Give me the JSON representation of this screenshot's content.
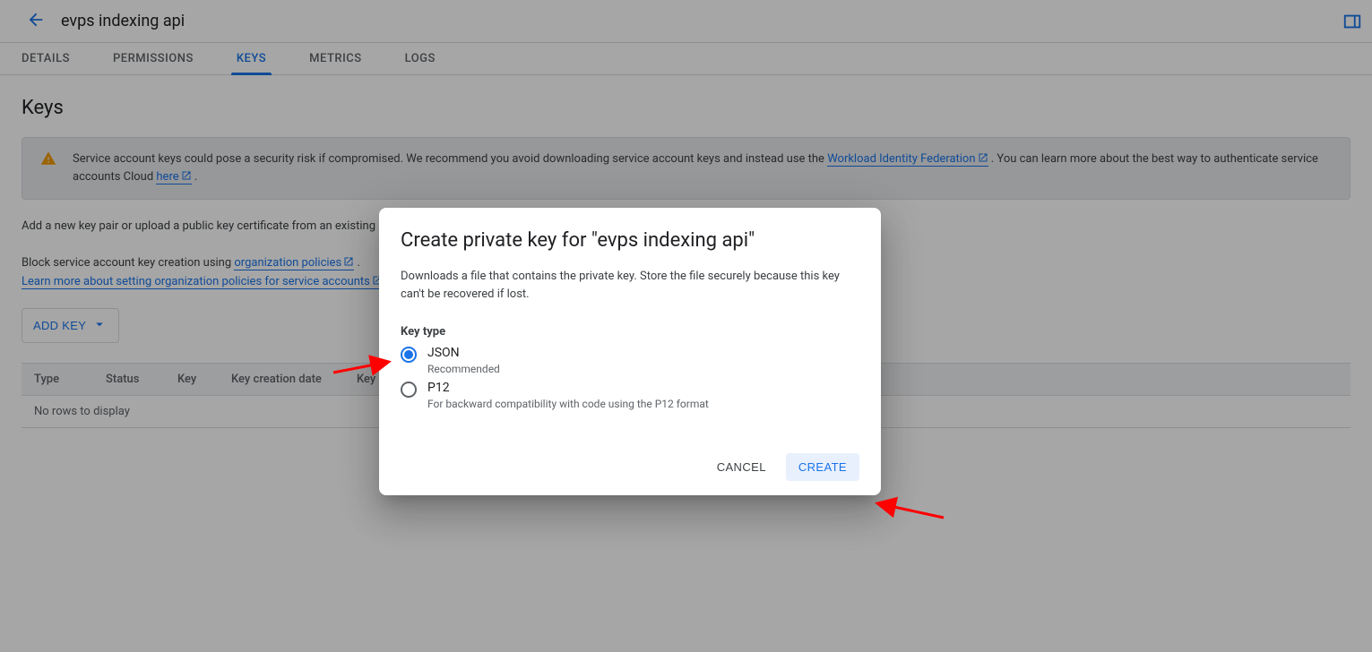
{
  "header": {
    "title": "evps indexing api"
  },
  "tabs": [
    "DETAILS",
    "PERMISSIONS",
    "KEYS",
    "METRICS",
    "LOGS"
  ],
  "active_tab_index": 2,
  "page_heading": "Keys",
  "alert": {
    "pre": "Service account keys could pose a security risk if compromised. We recommend you avoid downloading service account keys and instead use the ",
    "link1": "Workload Identity Federation",
    "mid": ". You can learn more about the best way to authenticate service accounts Cloud ",
    "link2": "here",
    "post": "."
  },
  "instructions": {
    "p1": "Add a new key pair or upload a public key certificate from an existing key pair.",
    "p2_pre": "Block service account key creation using ",
    "p2_link": "organization policies",
    "p2_post": ".",
    "p3_link": "Learn more about setting organization policies for service accounts"
  },
  "add_key_label": "ADD KEY",
  "table": {
    "cols": [
      "Type",
      "Status",
      "Key",
      "Key creation date",
      "Key expiration date"
    ],
    "empty": "No rows to display"
  },
  "dialog": {
    "title": "Create private key for \"evps indexing api\"",
    "desc": "Downloads a file that contains the private key. Store the file securely because this key can't be recovered if lost.",
    "key_type_label": "Key type",
    "options": [
      {
        "label": "JSON",
        "help": "Recommended",
        "selected": true
      },
      {
        "label": "P12",
        "help": "For backward compatibility with code using the P12 format",
        "selected": false
      }
    ],
    "cancel": "CANCEL",
    "create": "CREATE"
  }
}
